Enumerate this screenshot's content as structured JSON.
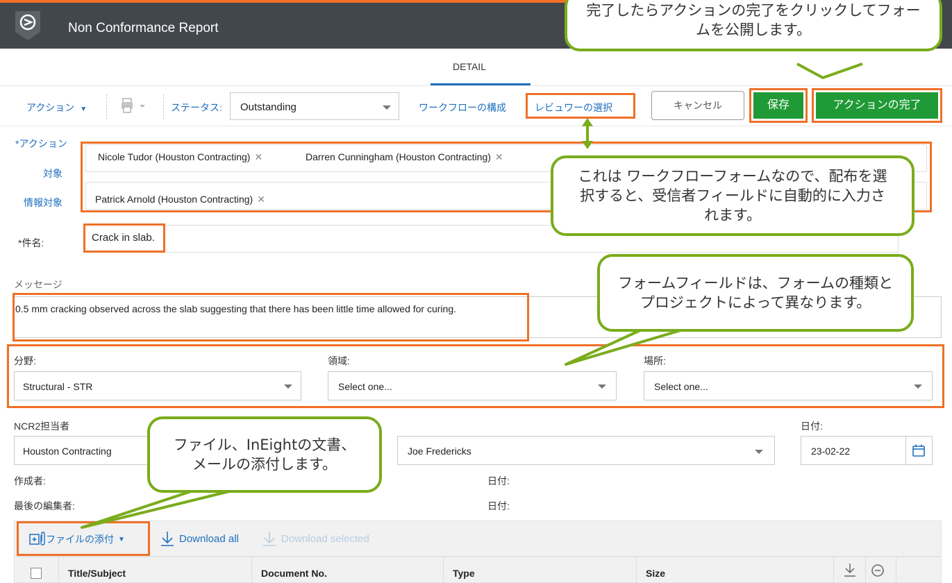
{
  "header": {
    "title": "Non Conformance Report",
    "bg": "#41474c"
  },
  "tabs": {
    "detail": "DETAIL"
  },
  "toolbar": {
    "action_label": "アクション",
    "status_label": "ステータス:",
    "status_value": "Outstanding",
    "workflow_link": "ワークフローの構成",
    "reviewer_link": "レビュワーの選択",
    "cancel_label": "キャンセル",
    "save_label": "保存",
    "complete_label": "アクションの完了",
    "accent_green": "#1f9a36"
  },
  "recipients": {
    "action_label": "*アクション",
    "to_label": "対象",
    "cc_label": "情報対象",
    "to_chips": [
      "Nicole Tudor (Houston Contracting)",
      "Darren Cunningham (Houston Contracting)"
    ],
    "cc_chips": [
      "Patrick Arnold (Houston Contracting)"
    ]
  },
  "subject": {
    "label": "*件名:",
    "value": "Crack in slab."
  },
  "message": {
    "label": "メッセージ",
    "value": "0.5 mm cracking observed across the slab suggesting that there has been little time allowed for curing."
  },
  "fields": {
    "discipline_label": "分野:",
    "discipline_value": "Structural - STR",
    "area_label": "領域:",
    "area_value": "Select one...",
    "location_label": "場所:",
    "location_value": "Select one...",
    "assignee_label": "NCR2担当者",
    "company_value": "Houston Contracting",
    "person_value": "Joe Fredericks",
    "date_label": "日付:",
    "date_value": "23-02-22",
    "created_by_label": "作成者:",
    "created_date_label": "日付:",
    "last_edited_label": "最後の編集者:",
    "edited_date_label": "日付:"
  },
  "attachments": {
    "attach_label": "ファイルの添付",
    "download_all": "Download all",
    "download_selected": "Download selected",
    "columns": [
      "Title/Subject",
      "Document No.",
      "Type",
      "Size"
    ]
  },
  "callouts": {
    "complete": "完了したらアクションの完了をクリックしてフォームを公開します。",
    "workflow": "これは ワークフローフォームなので、配布を選択すると、受信者フィールドに自動的に入力されます。",
    "fields": "フォームフィールドは、フォームの種類とプロジェクトによって異なります。",
    "attach": "ファイル、InEightの文書、メールの添付します。"
  },
  "icons": [
    "logo-icon",
    "print-icon",
    "calendar-icon",
    "attach-icon",
    "download-icon",
    "download-column-icon",
    "remove-column-icon"
  ]
}
